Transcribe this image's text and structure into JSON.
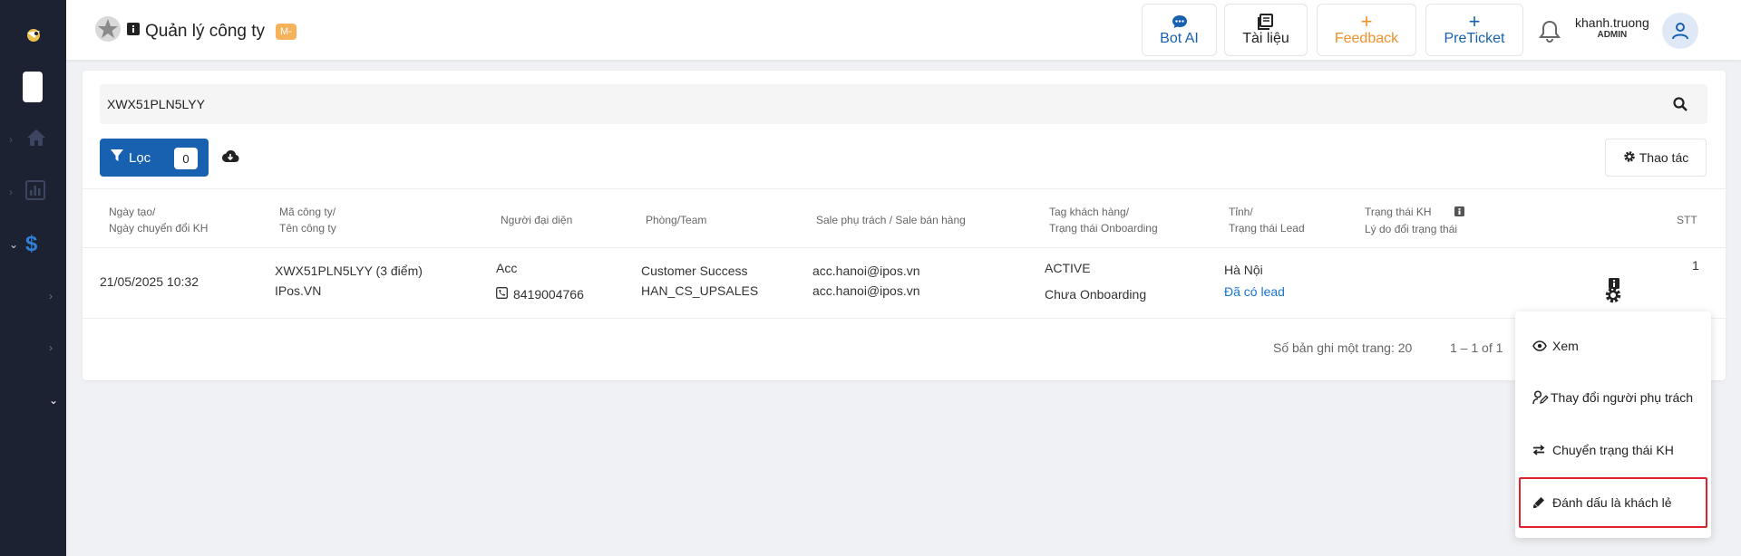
{
  "header": {
    "title": "Quản lý công ty",
    "tag": "M-",
    "buttons": [
      {
        "label": "Bot AI",
        "icon": "chat-icon",
        "color": "#1761b0"
      },
      {
        "label": "Tài liệu",
        "icon": "book-icon",
        "color": "#222222"
      },
      {
        "label": "Feedback",
        "icon": "plus-icon",
        "color": "#f0902a"
      },
      {
        "label": "PreTicket",
        "icon": "plus-icon",
        "color": "#1761b0"
      }
    ],
    "user": {
      "name": "khanh.truong",
      "role": "ADMIN"
    }
  },
  "search": {
    "value": "XWX51PLN5LYY"
  },
  "filter": {
    "label": "Lọc",
    "count": "0"
  },
  "actions": {
    "label": "Thao tác"
  },
  "table": {
    "headers": [
      {
        "l1": "Ngày tạo/",
        "l2": "Ngày chuyển đổi KH"
      },
      {
        "l1": "Mã công ty/",
        "l2": "Tên công ty"
      },
      {
        "l1": "Người đại diện",
        "l2": ""
      },
      {
        "l1": "Phòng/Team",
        "l2": ""
      },
      {
        "l1": "Sale phụ trách / Sale bán hàng",
        "l2": ""
      },
      {
        "l1": "Tag khách hàng/",
        "l2": "Trạng thái Onboarding"
      },
      {
        "l1": "Tỉnh/",
        "l2": "Trạng thái Lead"
      },
      {
        "l1": "Trạng thái KH",
        "l2": "Lý do đổi trạng thái"
      },
      {
        "l1": "STT",
        "l2": ""
      }
    ],
    "row": {
      "created": "21/05/2025 10:32",
      "company_code": "XWX51PLN5LYY (3 điểm)",
      "company_name": "IPos.VN",
      "rep_name": "Acc",
      "rep_phone": "8419004766",
      "dept": "Customer Success",
      "team": "HAN_CS_UPSALES",
      "sale1": "acc.hanoi@ipos.vn",
      "sale2": "acc.hanoi@ipos.vn",
      "tag": "ACTIVE",
      "onboarding": "Chưa Onboarding",
      "province": "Hà Nội",
      "lead_status": "Đã có lead",
      "stt": "1"
    }
  },
  "pager": {
    "per_page": "Số bản ghi một trang: 20",
    "range": "1 – 1 of 1"
  },
  "menu": {
    "items": [
      {
        "label": "Xem",
        "icon": "eye-icon"
      },
      {
        "label": "Thay đổi người phụ trách",
        "icon": "user-edit-icon"
      },
      {
        "label": "Chuyển trạng thái KH",
        "icon": "swap-icon"
      },
      {
        "label": "Đánh dấu là khách lẻ",
        "icon": "marker-icon"
      }
    ]
  },
  "colors": {
    "primary": "#1761b0",
    "sidebar": "#1d2233",
    "highlight": "#e0222e",
    "feedback": "#f0902a"
  }
}
